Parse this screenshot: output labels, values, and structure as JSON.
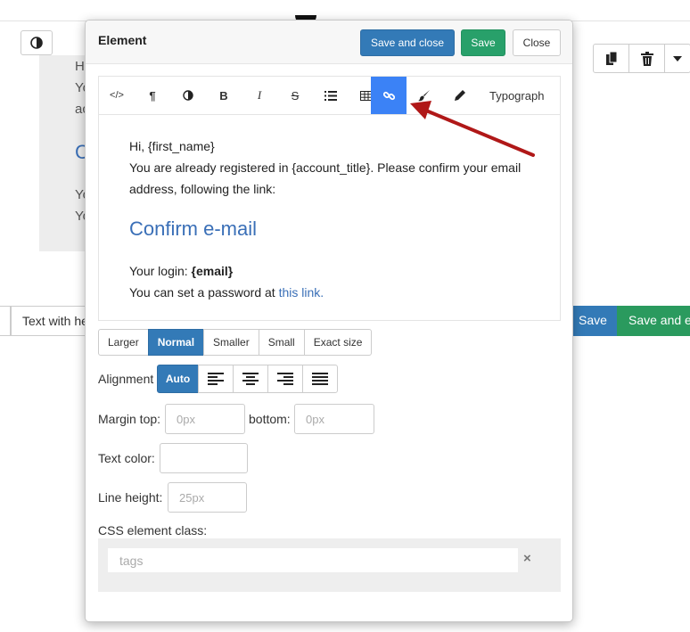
{
  "background": {
    "text_with_label": "Text with he",
    "save_label": "Save",
    "save_and_exit_label": "Save and e",
    "preview_letters": [
      "H",
      "Yo",
      "ac",
      "C",
      "Yo",
      "Yo"
    ]
  },
  "modal": {
    "title": "Element",
    "save_close_label": "Save and close",
    "save_label": "Save",
    "close_label": "Close"
  },
  "toolbar": {
    "code_label": "</>",
    "paragraph_label": "¶",
    "bold_label": "B",
    "italic_label": "I",
    "strike_label": "S",
    "typograph_label": "Typograph"
  },
  "content": {
    "greeting": "Hi, {first_name}",
    "line1": "You are already registered in {account_title}. Please confirm your email address, following the link:",
    "confirm_link": "Confirm e-mail",
    "login_prefix": "Your login: ",
    "login_value": "{email}",
    "password_prefix": "You can set a password at ",
    "password_link": "this link."
  },
  "size_options": [
    "Larger",
    "Normal",
    "Smaller",
    "Small",
    "Exact size"
  ],
  "size_selected": "Normal",
  "alignment": {
    "label": "Alignment",
    "auto_label": "Auto"
  },
  "margin": {
    "top_label": "Margin top:",
    "top_placeholder": "0px",
    "bottom_label": "bottom:",
    "bottom_placeholder": "0px"
  },
  "text_color_label": "Text color:",
  "line_height": {
    "label": "Line height:",
    "placeholder": "25px"
  },
  "css_class": {
    "label": "CSS element class:",
    "placeholder": "tags",
    "clear_icon": "×"
  },
  "colors": {
    "primary": "#337ab7",
    "success": "#28a06a",
    "active_tool": "#3b82f6",
    "arrow": "#b01818",
    "link": "#3a6fb7"
  }
}
